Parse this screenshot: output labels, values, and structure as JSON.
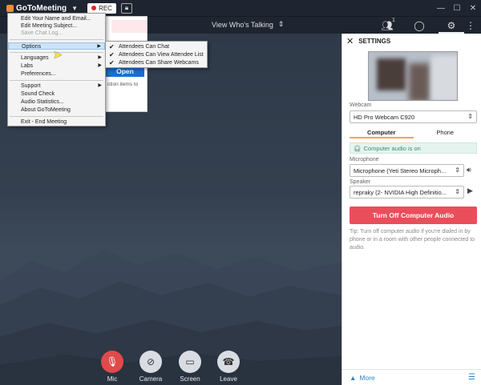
{
  "titlebar": {
    "app_name": "GoToMeeting",
    "rec_label": "REC"
  },
  "toolbar": {
    "view_label": "View Who's Talking",
    "people_count": "1"
  },
  "menu": {
    "items": [
      {
        "label": "Edit Your Name and Email..."
      },
      {
        "label": "Edit Meeting Subject..."
      },
      {
        "label": "Save Chat Log..."
      },
      {
        "label": "Options"
      },
      {
        "label": "Languages"
      },
      {
        "label": "Labs"
      },
      {
        "label": "Preferences..."
      },
      {
        "label": "Support"
      },
      {
        "label": "Sound Check"
      },
      {
        "label": "Audio Statistics..."
      },
      {
        "label": "About GoToMeeting"
      },
      {
        "label": "Exit - End Meeting"
      }
    ],
    "submenu": [
      {
        "label": "Attendees Can Chat"
      },
      {
        "label": "Attendees Can View Attendee List"
      },
      {
        "label": "Attendees Can Share Webcams"
      }
    ]
  },
  "backpanel": {
    "open_label": "Open",
    "text": "ction items to"
  },
  "controls": {
    "mic": "Mic",
    "camera": "Camera",
    "screen": "Screen",
    "leave": "Leave"
  },
  "settings": {
    "title": "SETTINGS",
    "webcam_label": "Webcam",
    "webcam_value": "HD Pro Webcam C920",
    "tab_computer": "Computer",
    "tab_phone": "Phone",
    "audio_status": "Computer audio is on",
    "microphone_label": "Microphone",
    "microphone_value": "Microphone (Yeti Stereo Microph...",
    "speaker_label": "Speaker",
    "speaker_value": "repraky (2- NVIDIA High Definitio...",
    "turn_off_label": "Turn Off Computer Audio",
    "tip": "Tip: Turn off computer audio if you're dialed in by phone or in a room with other people connected to audio.",
    "more_label": "More"
  },
  "colors": {
    "accent_red": "#ea4e5b",
    "link_blue": "#2f86c9",
    "brand_orange": "#f68d2e"
  }
}
